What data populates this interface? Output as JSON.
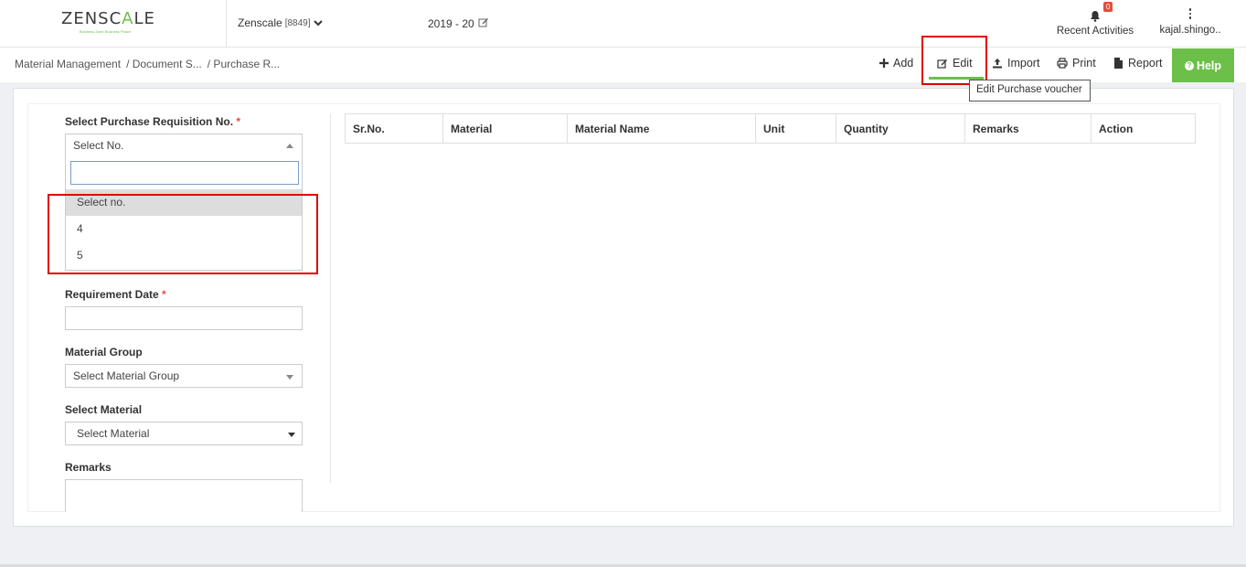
{
  "header": {
    "logo": {
      "prefix": "ZENSC",
      "accent": "A",
      "suffix": "LE",
      "tagline": "Business Zone Business Peace"
    },
    "company_name": "Zenscale",
    "company_code": "[8849]",
    "fiscal_year": "2019 - 20",
    "notifications_count": "0",
    "recent_activities_label": "Recent Activities",
    "user_label": "kajal.shingo.."
  },
  "breadcrumb": [
    "Material Management",
    "/ Document S...",
    "/ Purchase R..."
  ],
  "toolbar": {
    "add_label": "Add",
    "edit_label": "Edit",
    "import_label": "Import",
    "print_label": "Print",
    "report_label": "Report",
    "help_label": "Help",
    "edit_tooltip": "Edit Purchase voucher"
  },
  "form": {
    "requisition_label": "Select Purchase Requisition No.",
    "required_mark": "*",
    "requisition_value": "Select No.",
    "requisition_options": [
      "Select no.",
      "4",
      "5"
    ],
    "requirement_date_label": "Requirement Date",
    "requirement_date_value": "",
    "material_group_label": "Material Group",
    "material_group_value": "Select Material Group",
    "select_material_label": "Select Material",
    "select_material_value": "Select Material",
    "remarks_label": "Remarks",
    "remarks_value": ""
  },
  "table": {
    "columns": [
      "Sr.No.",
      "Material",
      "Material Name",
      "Unit",
      "Quantity",
      "Remarks",
      "Action"
    ]
  },
  "colors": {
    "accent": "#6cc04a",
    "highlight": "#e00000",
    "badge": "#e74c3c"
  }
}
